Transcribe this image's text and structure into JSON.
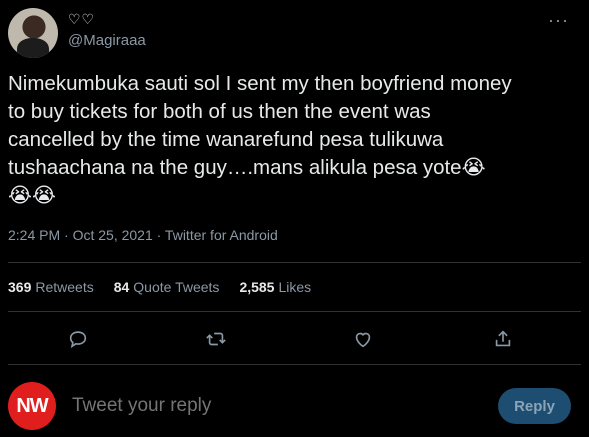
{
  "header": {
    "display_name": "♡♡",
    "handle": "@Magiraaa",
    "more_icon": "more-icon"
  },
  "tweet": {
    "lines": [
      "Nimekumbuka sauti sol I sent my then boyfriend money",
      "to buy tickets for both of us then the event was",
      "cancelled by the time wanarefund pesa tulikuwa",
      "tushaachana na the guy….mans alikula pesa yote😭",
      "😭😭"
    ],
    "meta": "2:24 PM · Oct 25, 2021 · Twitter for Android"
  },
  "stats": {
    "retweets_count": "369",
    "retweets_label": "Retweets",
    "quotes_count": "84",
    "quotes_label": "Quote Tweets",
    "likes_count": "2,585",
    "likes_label": "Likes"
  },
  "actions": [
    "reply-icon",
    "retweet-icon",
    "like-icon",
    "share-icon"
  ],
  "reply_box": {
    "avatar_text": "NW",
    "placeholder": "Tweet your reply",
    "button_label": "Reply"
  },
  "colors": {
    "background": "#000000",
    "text": "#e7e9ea",
    "secondary": "#8b98a5",
    "accent_button": "#1d4d70",
    "nw_avatar": "#e01e1e"
  }
}
